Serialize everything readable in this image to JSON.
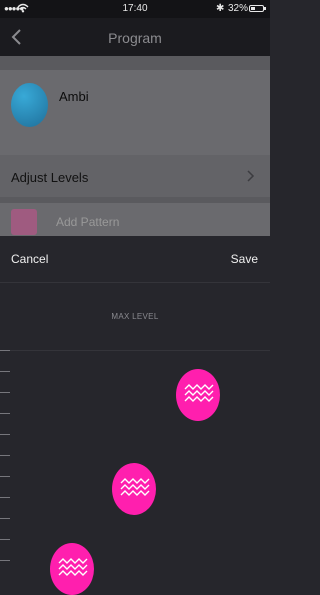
{
  "status_bar": {
    "signal": "●●●●●",
    "time": "17:40",
    "bluetooth": "✱",
    "battery_percent": "32%",
    "battery_level": 0.32
  },
  "navbar": {
    "title": "Program",
    "back_icon": "chevron-left-icon"
  },
  "program": {
    "name": "Ambi",
    "adjust_label": "Adjust Levels",
    "pattern_label": "Add Pattern"
  },
  "sheet": {
    "cancel_label": "Cancel",
    "save_label": "Save",
    "max_level_label": "MAX LEVEL"
  },
  "colors": {
    "accent": "#ff1fae",
    "background": "#26262c",
    "navbar": "#1b1b1f"
  },
  "level_points": [
    {
      "name": "level-point-1",
      "level": 0.07
    },
    {
      "name": "level-point-2",
      "level": 0.41
    },
    {
      "name": "level-point-3",
      "level": 0.81
    }
  ]
}
